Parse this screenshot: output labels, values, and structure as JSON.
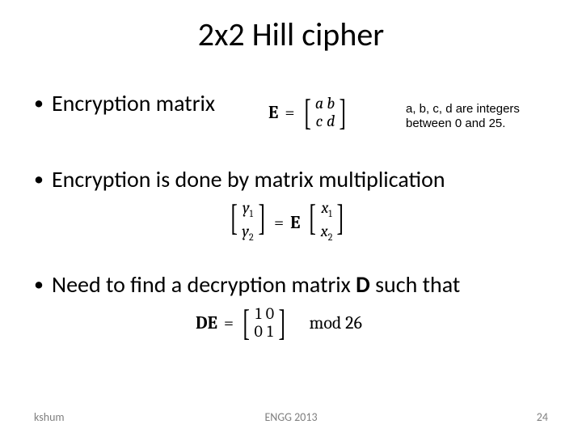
{
  "title": "2x2 Hill cipher",
  "bullets": {
    "b1": "Encryption matrix",
    "b2": "Encryption is done by matrix multiplication",
    "b3_a": "Need to find a decryption matrix ",
    "b3_D": "D",
    "b3_b": " such that"
  },
  "note": {
    "line1": "a, b, c, d are integers",
    "line2": "between 0 and 25."
  },
  "eq1": {
    "lhs": "E",
    "eq": "=",
    "m": {
      "r1c1": "a",
      "r1c2": "b",
      "r2c1": "c",
      "r2c2": "d"
    }
  },
  "eq2": {
    "ylabel1": "y",
    "ylabel2": "y",
    "sub1": "1",
    "sub2": "2",
    "eq": "=",
    "E": "E",
    "xlabel1": "x",
    "xlabel2": "x"
  },
  "eq3": {
    "lhs": "DE",
    "eq": "=",
    "m": {
      "r1c1": "1",
      "r1c2": "0",
      "r2c1": "0",
      "r2c2": "1"
    },
    "mod": "mod 26"
  },
  "footer": {
    "left": "kshum",
    "center": "ENGG 2013",
    "right": "24"
  }
}
